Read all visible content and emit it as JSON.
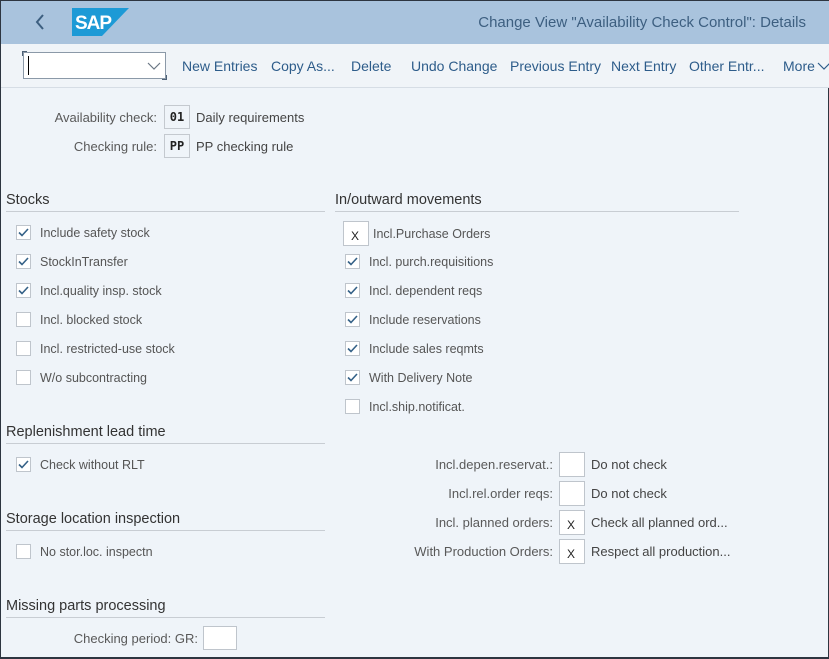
{
  "header": {
    "title": "Change View \"Availability Check Control\": Details",
    "logo_text": "SAP",
    "brand_color": "#1d9ad6",
    "header_bg": "#a9c3dd"
  },
  "toolbar": {
    "command_field_value": "",
    "buttons": [
      {
        "label": "New Entries"
      },
      {
        "label": "Copy As..."
      },
      {
        "label": "Delete"
      },
      {
        "label": "Undo Change"
      },
      {
        "label": "Previous Entry"
      },
      {
        "label": "Next Entry"
      },
      {
        "label": "Other Entr..."
      },
      {
        "label": "More"
      }
    ]
  },
  "keys": {
    "availability_check": {
      "label": "Availability check:",
      "value": "01",
      "desc": "Daily requirements"
    },
    "checking_rule": {
      "label": "Checking rule:",
      "value": "PP",
      "desc": "PP checking rule"
    }
  },
  "stocks": {
    "title": "Stocks",
    "items": [
      {
        "label": "Include safety stock",
        "checked": true
      },
      {
        "label": "StockInTransfer",
        "checked": true
      },
      {
        "label": "Incl.quality insp. stock",
        "checked": true
      },
      {
        "label": "Incl. blocked stock",
        "checked": false
      },
      {
        "label": "Incl. restricted-use stock",
        "checked": false
      },
      {
        "label": "W/o subcontracting",
        "checked": false
      }
    ]
  },
  "movements": {
    "title": "In/outward movements",
    "purchase_orders": {
      "label": "Incl.Purchase Orders",
      "value": "X"
    },
    "items": [
      {
        "label": "Incl. purch.requisitions",
        "checked": true
      },
      {
        "label": "Incl. dependent reqs",
        "checked": true
      },
      {
        "label": "Include reservations",
        "checked": true
      },
      {
        "label": "Include sales reqmts",
        "checked": true
      },
      {
        "label": "With Delivery Note",
        "checked": true
      },
      {
        "label": "Incl.ship.notificat.",
        "checked": false
      }
    ],
    "fields": [
      {
        "label": "Incl.depen.reservat.:",
        "value": "",
        "desc": "Do not check"
      },
      {
        "label": "Incl.rel.order reqs:",
        "value": "",
        "desc": "Do not check"
      },
      {
        "label": "Incl. planned orders:",
        "value": "X",
        "desc": "Check all planned ord..."
      },
      {
        "label": "With Production Orders:",
        "value": "X",
        "desc": "Respect all production..."
      }
    ]
  },
  "replenishment": {
    "title": "Replenishment lead time",
    "items": [
      {
        "label": "Check without RLT",
        "checked": true
      }
    ]
  },
  "storage": {
    "title": "Storage location inspection",
    "items": [
      {
        "label": "No stor.loc. inspectn",
        "checked": false
      }
    ]
  },
  "missing_parts": {
    "title": "Missing parts processing",
    "checking_period": {
      "label": "Checking period: GR:",
      "value": ""
    }
  }
}
